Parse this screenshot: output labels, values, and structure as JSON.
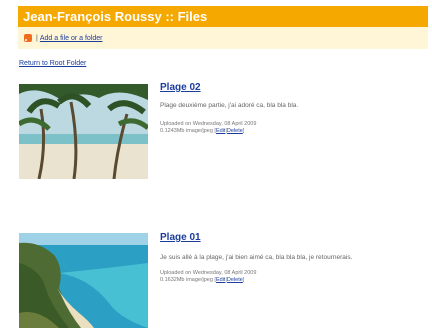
{
  "header": {
    "title": "Jean-François Roussy :: Files"
  },
  "toolbar": {
    "add_label": "Add a file or a folder",
    "separator": "|"
  },
  "nav": {
    "return_label": "Return to Root Folder"
  },
  "files": [
    {
      "title": "Plage 02",
      "description": "Plage deuxième partie, j'ai adoré ca, bla bla bla.",
      "uploaded": "Uploaded on Wednesday, 08 April 2009",
      "info": "0.1243Mb image/jpeg",
      "edit": "Edit",
      "delete": "Delete"
    },
    {
      "title": "Plage 01",
      "description": "Je suis allé à la plage, j'ai bien aimé ca, bla bla bla, je retournerais.",
      "uploaded": "Uploaded on Wednesday, 08 April 2009",
      "info": "0.1632Mb image/jpeg",
      "edit": "Edit",
      "delete": "Delete"
    }
  ]
}
